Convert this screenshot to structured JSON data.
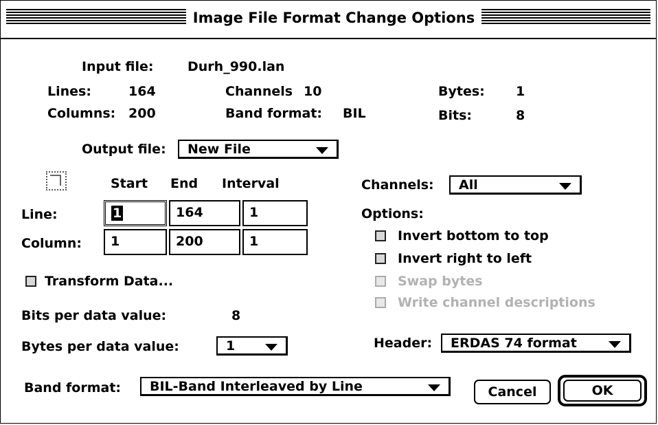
{
  "window": {
    "title": "Image File Format Change Options"
  },
  "input_file": {
    "label": "Input file:",
    "value": "Durh_990.lan"
  },
  "info": {
    "lines_label": "Lines:",
    "lines_value": "164",
    "columns_label": "Columns:",
    "columns_value": "200",
    "channels_label": "Channels",
    "channels_value": "10",
    "band_format_label": "Band format:",
    "band_format_value": "BIL",
    "bytes_label": "Bytes:",
    "bytes_value": "1",
    "bits_label": "Bits:",
    "bits_value": "8"
  },
  "output_file": {
    "label": "Output file:",
    "value": "New File"
  },
  "table": {
    "headers": {
      "start": "Start",
      "end": "End",
      "interval": "Interval"
    },
    "line_label": "Line:",
    "column_label": "Column:",
    "line": {
      "start": "1",
      "end": "164",
      "interval": "1"
    },
    "column": {
      "start": "1",
      "end": "200",
      "interval": "1"
    }
  },
  "channels": {
    "label": "Channels:",
    "value": "All"
  },
  "options": {
    "label": "Options:",
    "invert_bottom_to_top": "Invert bottom to top",
    "invert_right_to_left": "Invert right to left",
    "swap_bytes": "Swap bytes",
    "write_channel_descriptions": "Write channel descriptions"
  },
  "transform_data": "Transform Data...",
  "bits_per_value": {
    "label": "Bits per data value:",
    "value": "8"
  },
  "bytes_per_value": {
    "label": "Bytes per data value:",
    "value": "1"
  },
  "header": {
    "label": "Header:",
    "value": "ERDAS 74 format"
  },
  "band_format": {
    "label": "Band format:",
    "value": "BIL-Band Interleaved by Line"
  },
  "buttons": {
    "cancel": "Cancel",
    "ok": "OK"
  },
  "icons": {
    "zoom": "zoom-box-icon",
    "dropdown": "triangle-down-icon"
  }
}
